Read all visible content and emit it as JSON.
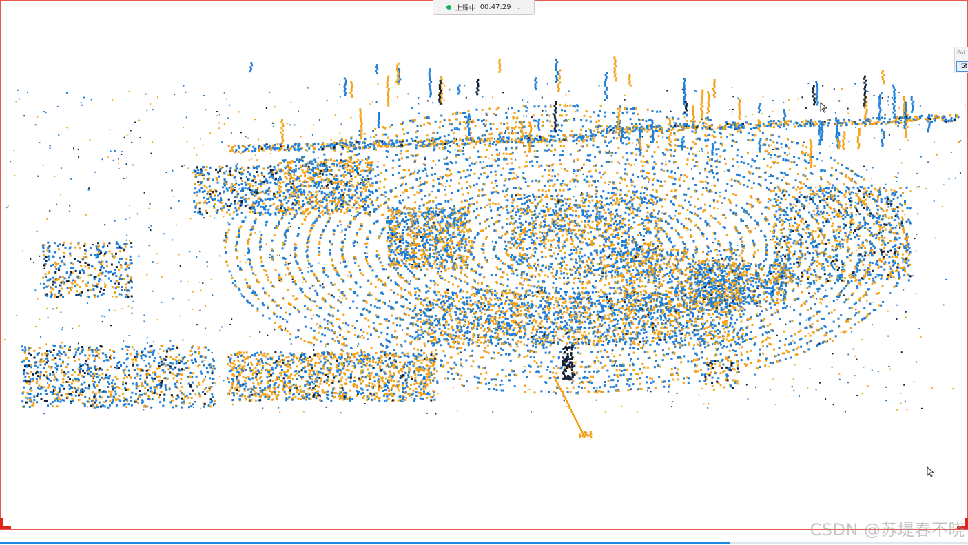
{
  "status": {
    "label": "上课中",
    "timer": "00:47:29",
    "dot_color": "#16b35a"
  },
  "side_panel": {
    "title": "Poi",
    "button_label": "St"
  },
  "watermark": "CSDN @苏堤春不晓",
  "colors": {
    "blue": "#1f7fd8",
    "orange": "#f4a318",
    "dark": "#11223a",
    "frame": "#e85a4f",
    "progress": "#1e88e5"
  },
  "icons": {
    "cursor": "arrow-cursor-icon",
    "chevron": "chevron-down-icon",
    "record": "record-dot-icon"
  }
}
